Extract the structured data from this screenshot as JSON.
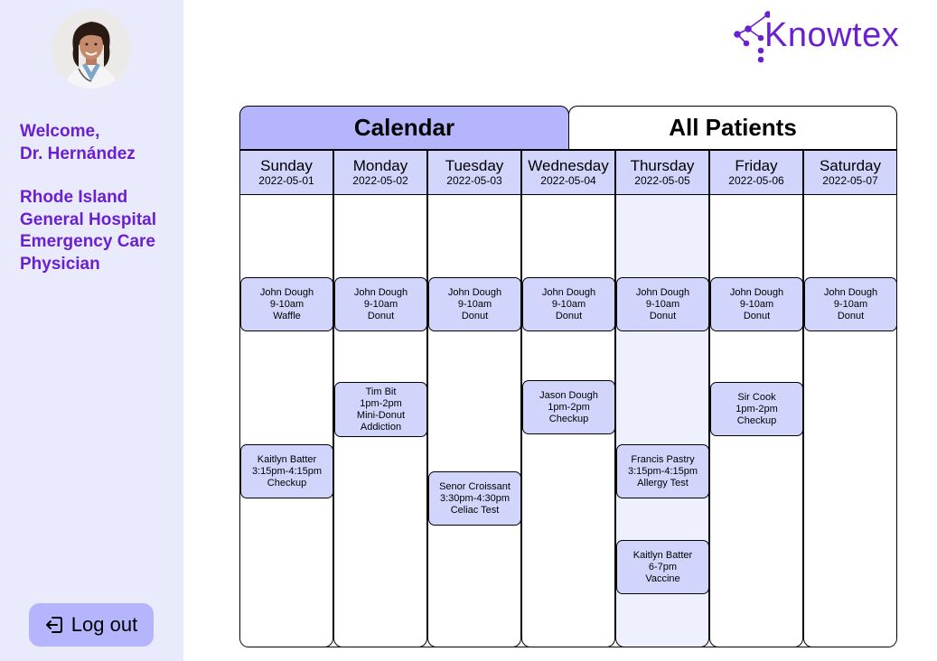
{
  "sidebar": {
    "welcome_line1": "Welcome,",
    "welcome_line2": "Dr. Hernández",
    "hospital_line1": "Rhode Island",
    "hospital_line2": "General Hospital",
    "hospital_line3": "Emergency Care",
    "hospital_line4": "Physician",
    "logout_label": "Log out"
  },
  "brand": {
    "name": "Knowtex"
  },
  "tabs": {
    "calendar": "Calendar",
    "patients": "All Patients"
  },
  "colors": {
    "accent": "#6a1fd1",
    "tab_active": "#b4b5fc",
    "event": "#d1d5fb",
    "sidebar_bg": "#e9ebfd"
  },
  "days": [
    {
      "name": "Sunday",
      "date": "2022-05-01",
      "today": false,
      "events": [
        {
          "who": "John Dough",
          "time": "9-10am",
          "what": "Waffle"
        },
        {
          "who": "Kaitlyn Batter",
          "time": "3:15pm-4:15pm",
          "what": "Checkup"
        }
      ]
    },
    {
      "name": "Monday",
      "date": "2022-05-02",
      "today": false,
      "events": [
        {
          "who": "John Dough",
          "time": "9-10am",
          "what": "Donut"
        },
        {
          "who": "Tim Bit",
          "time": "1pm-2pm",
          "what": "Mini-Donut",
          "what2": "Addiction"
        }
      ]
    },
    {
      "name": "Tuesday",
      "date": "2022-05-03",
      "today": false,
      "events": [
        {
          "who": "John Dough",
          "time": "9-10am",
          "what": "Donut"
        },
        {
          "who": "Senor Croissant",
          "time": "3:30pm-4:30pm",
          "what": "Celiac Test"
        }
      ]
    },
    {
      "name": "Wednesday",
      "date": "2022-05-04",
      "today": false,
      "events": [
        {
          "who": "John Dough",
          "time": "9-10am",
          "what": "Donut"
        },
        {
          "who": "Jason Dough",
          "time": "1pm-2pm",
          "what": "Checkup"
        }
      ]
    },
    {
      "name": "Thursday",
      "date": "2022-05-05",
      "today": true,
      "events": [
        {
          "who": "John Dough",
          "time": "9-10am",
          "what": "Donut"
        },
        {
          "who": "Francis Pastry",
          "time": "3:15pm-4:15pm",
          "what": "Allergy Test"
        },
        {
          "who": "Kaitlyn Batter",
          "time": "6-7pm",
          "what": "Vaccine"
        }
      ]
    },
    {
      "name": "Friday",
      "date": "2022-05-06",
      "today": false,
      "events": [
        {
          "who": "John Dough",
          "time": "9-10am",
          "what": "Donut"
        },
        {
          "who": "Sir Cook",
          "time": "1pm-2pm",
          "what": "Checkup"
        }
      ]
    },
    {
      "name": "Saturday",
      "date": "2022-05-07",
      "today": false,
      "events": [
        {
          "who": "John Dough",
          "time": "9-10am",
          "what": "Donut"
        }
      ]
    }
  ]
}
